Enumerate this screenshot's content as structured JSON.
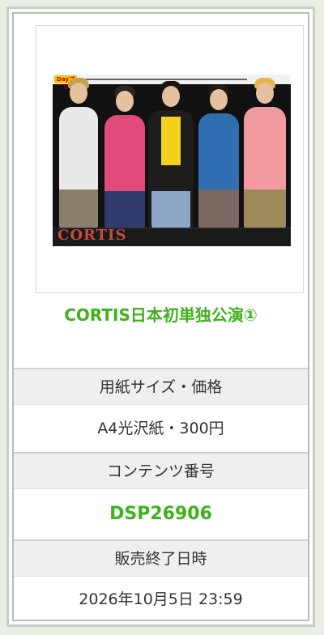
{
  "product": {
    "title": "CORTIS日本初単独公演①",
    "thumbnail": {
      "alt": "CORTIS 5 members group photo",
      "logo_text": "Dayプリ",
      "caption_text": "CORTIS"
    }
  },
  "specs": [
    {
      "label": "用紙サイズ・価格",
      "value": "A4光沢紙・300円"
    },
    {
      "label": "コンテンツ番号",
      "value": "DSP26906"
    },
    {
      "label": "販売終了日時",
      "value": "2026年10月5日 23:59"
    }
  ],
  "colors": {
    "accent_green": "#3db21a",
    "label_bg": "#efefef",
    "border": "#c9ccc7"
  }
}
